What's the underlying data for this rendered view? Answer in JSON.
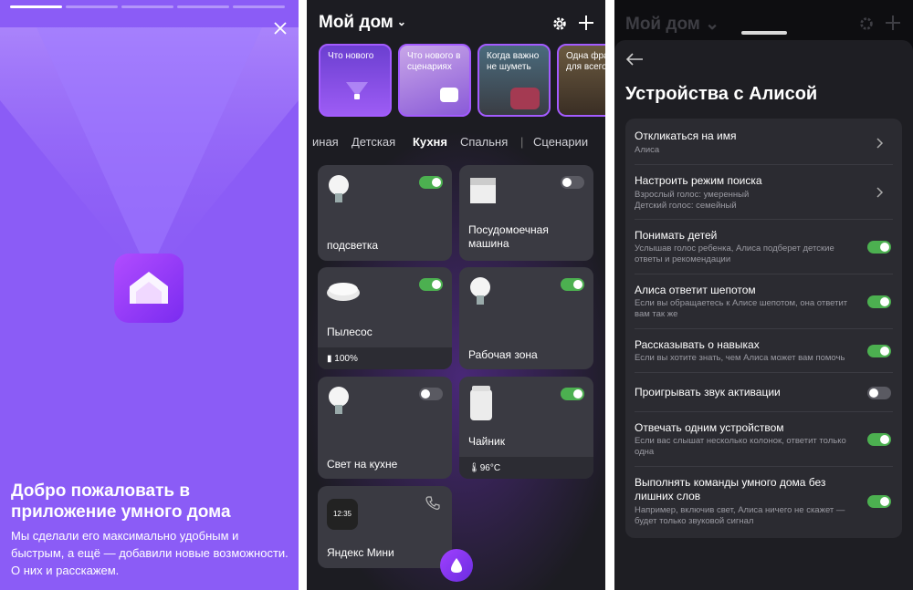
{
  "welcome": {
    "title": "Добро пожаловать в приложение умного дома",
    "body": "Мы сделали его максимально удобным и быстрым, а ещё — добавили новые возможности. О них и расскажем."
  },
  "home": {
    "title": "Мой дом",
    "stories": [
      "Что нового",
      "Что нового в сценариях",
      "Когда важно не шуметь",
      "Одна фраза для всего"
    ],
    "tabs": [
      "иная",
      "Детская",
      "Кухня",
      "Спальня",
      "|",
      "Сценарии"
    ],
    "devices": [
      {
        "name": "подсветка",
        "on": true
      },
      {
        "name": "Посудомоечная машина",
        "on": false
      },
      {
        "name": "Пылесос",
        "on": true,
        "status": "100%"
      },
      {
        "name": "Рабочая зона",
        "on": true
      },
      {
        "name": "Свет на кухне",
        "on": false
      },
      {
        "name": "Чайник",
        "on": true,
        "status": "96°C"
      },
      {
        "name": "Яндекс Мини",
        "clock": "12:35"
      }
    ]
  },
  "settings": {
    "dim_title": "Мой дом",
    "title": "Устройства с Алисой",
    "items": [
      {
        "title": "Откликаться на имя",
        "sub": "Алиса",
        "type": "arrow"
      },
      {
        "title": "Настроить режим поиска",
        "sub": "Взрослый голос: умеренный\nДетский голос: семейный",
        "type": "arrow"
      },
      {
        "title": "Понимать детей",
        "sub": "Услышав голос ребенка, Алиса подберет детские ответы и рекомендации",
        "type": "toggle",
        "on": true
      },
      {
        "title": "Алиса ответит шепотом",
        "sub": "Если вы обращаетесь к Алисе шепотом, она ответит вам так же",
        "type": "toggle",
        "on": true
      },
      {
        "title": "Рассказывать о навыках",
        "sub": "Если вы хотите знать, чем Алиса может вам помочь",
        "type": "toggle",
        "on": true
      },
      {
        "title": "Проигрывать звук активации",
        "sub": "",
        "type": "toggle",
        "on": false
      },
      {
        "title": "Отвечать одним устройством",
        "sub": "Если вас слышат несколько колонок, ответит только одна",
        "type": "toggle",
        "on": true
      },
      {
        "title": "Выполнять команды умного дома без лишних слов",
        "sub": "Например, включив свет, Алиса ничего не скажет — будет только звуковой сигнал",
        "type": "toggle",
        "on": true
      }
    ]
  },
  "colors": {
    "purple": "#8b5cf6",
    "toggle_on": "#4cb050",
    "dark_bg": "#1c1c22"
  }
}
